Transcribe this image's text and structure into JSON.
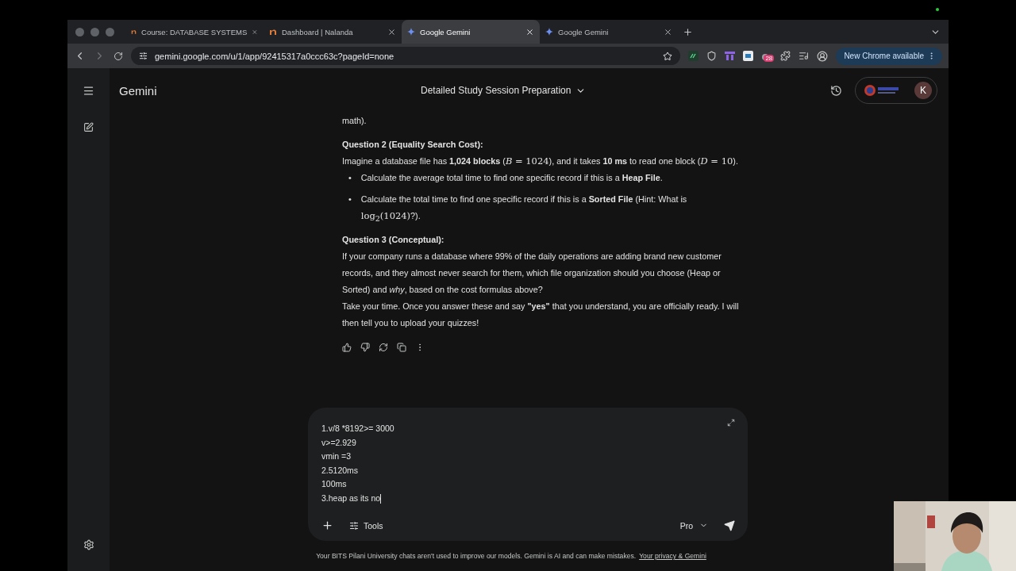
{
  "browser": {
    "tabs": [
      {
        "title": "Course: DATABASE SYSTEMS",
        "kind": "nalanda",
        "selected": false
      },
      {
        "title": "Dashboard | Nalanda",
        "kind": "nalanda",
        "selected": false
      },
      {
        "title": "Google Gemini",
        "kind": "gemini",
        "selected": true
      },
      {
        "title": "Google Gemini",
        "kind": "gemini",
        "selected": false
      }
    ],
    "address": "gemini.google.com/u/1/app/92415317a0ccc63c?pageId=none",
    "extension_badge": "28",
    "update_button": "New Chrome available"
  },
  "app": {
    "name": "Gemini",
    "chat_title": "Detailed Study Session Preparation",
    "avatar": "K"
  },
  "message": [
    {
      "kind": "paragraph",
      "parts": [
        {
          "kind": "text",
          "text": "math)."
        }
      ]
    },
    {
      "kind": "heading",
      "text": "Question 2 (Equality Search Cost):"
    },
    {
      "kind": "paragraph",
      "tight": true,
      "parts": [
        {
          "kind": "text",
          "text": "Imagine a database file has **1,024 blocks** ("
        },
        {
          "kind": "math",
          "text": "*B* = 1024"
        },
        {
          "kind": "text",
          "text": "), and it takes **10 ms** to read one block ("
        },
        {
          "kind": "math",
          "text": "*D* = 10"
        },
        {
          "kind": "text",
          "text": ")."
        }
      ]
    },
    {
      "kind": "bullets",
      "marker": "•",
      "items": [
        [
          {
            "kind": "text",
            "text": "Calculate the average total time to find one specific record if this is a **Heap File**."
          }
        ],
        [
          {
            "kind": "text",
            "text": "Calculate the total time to find one specific record if this is a **Sorted File** (Hint: What is "
          },
          {
            "kind": "math",
            "text": "log$_{2}$(1024)"
          },
          {
            "kind": "text",
            "text": "?)."
          }
        ]
      ]
    },
    {
      "kind": "heading",
      "text": "Question 3 (Conceptual):"
    },
    {
      "kind": "paragraph",
      "tight": true,
      "parts": [
        {
          "kind": "text",
          "text": "If your company runs a database where 99% of the daily operations are adding brand new customer records, and they almost never search for them, which file organization should you choose (Heap or Sorted) and *why*, based on the cost formulas above?"
        }
      ]
    },
    {
      "kind": "paragraph",
      "parts": [
        {
          "kind": "text",
          "text": "Take your time. Once you answer these and say **\"yes\"** that you understand, you are officially ready. I will then tell you to upload your quizzes!"
        }
      ]
    }
  ],
  "prompt": {
    "lines": [
      "1.v/8 *8192>= 3000",
      "v>=2.929",
      "vmin =3",
      "2.5120ms",
      "100ms",
      "3.heap as its no"
    ],
    "tools_label": "Tools",
    "model": "Pro"
  },
  "footer": {
    "notice": "Your BITS Pilani University chats aren't used to improve our models. Gemini is AI and can make mistakes.",
    "link": "Your privacy & Gemini"
  }
}
